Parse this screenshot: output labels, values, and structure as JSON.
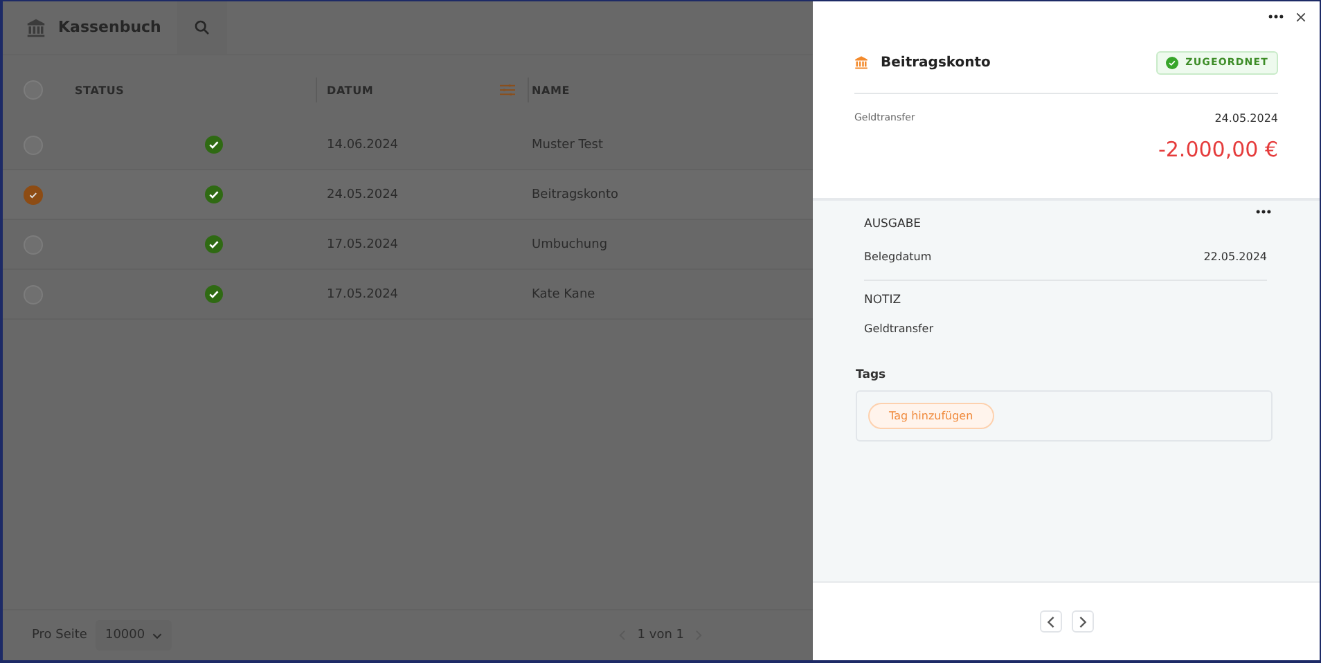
{
  "header": {
    "title": "Kassenbuch"
  },
  "table": {
    "all_selected": false,
    "columns": [
      "STATUS",
      "DATUM",
      "NAME"
    ],
    "rows": [
      {
        "selected": false,
        "assigned": true,
        "date": "14.06.2024",
        "name": "Muster Test"
      },
      {
        "selected": true,
        "assigned": true,
        "date": "24.05.2024",
        "name": "Beitragskonto"
      },
      {
        "selected": false,
        "assigned": true,
        "date": "17.05.2024",
        "name": "Umbuchung"
      },
      {
        "selected": false,
        "assigned": true,
        "date": "17.05.2024",
        "name": "Kate Kane"
      }
    ]
  },
  "footer": {
    "per_page_label": "Pro Seite",
    "per_page": "10000",
    "page_info": "1 von 1"
  },
  "detail": {
    "title": "Beitragskonto",
    "badge": "ZUGEORDNET",
    "type": "Geldtransfer",
    "date": "24.05.2024",
    "amount": "-2.000,00 €",
    "section": "AUSGABE",
    "field_label": "Belegdatum",
    "field_value": "22.05.2024",
    "note_heading": "NOTIZ",
    "note": "Geldtransfer",
    "tags_heading": "Tags",
    "add_tag": "Tag hinzufügen"
  }
}
